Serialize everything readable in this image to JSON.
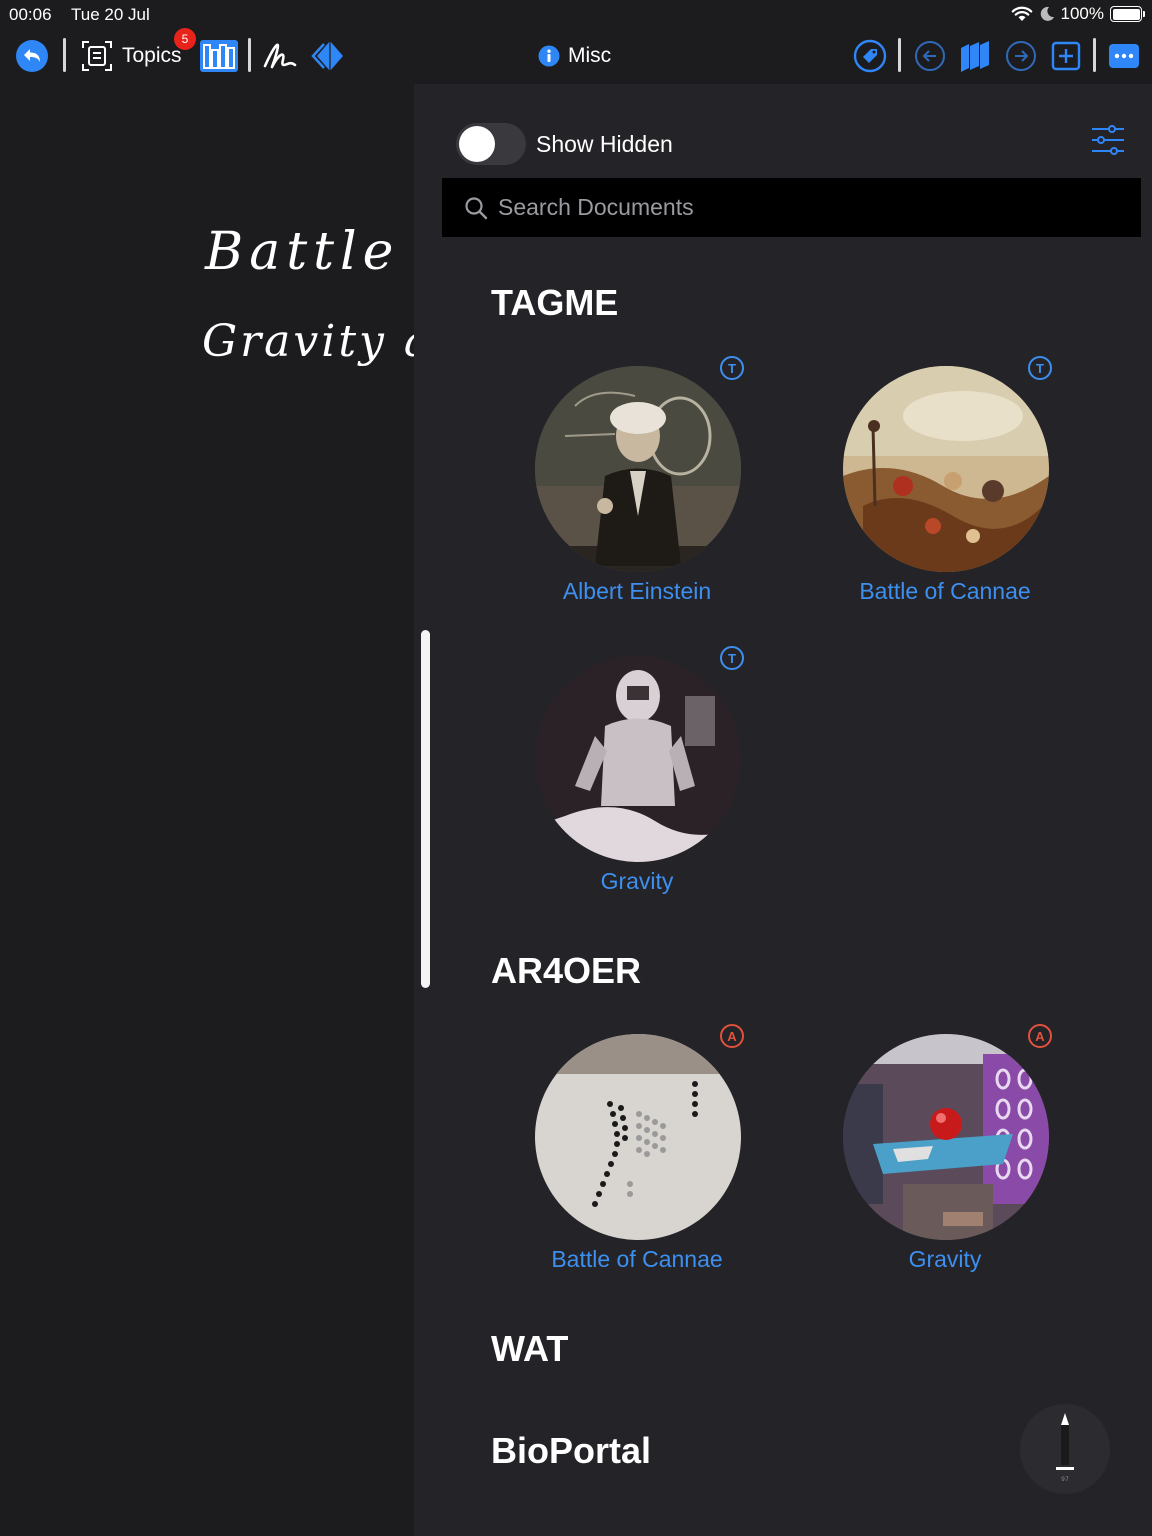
{
  "status": {
    "time": "00:06",
    "date": "Tue 20 Jul",
    "battery": "100%"
  },
  "toolbar": {
    "topics_label": "Topics",
    "topics_badge": "5",
    "title": "Misc"
  },
  "note": {
    "line1": "Battle of",
    "line2": "Gravity and"
  },
  "library": {
    "show_hidden_label": "Show Hidden",
    "show_hidden_on": false,
    "search_placeholder": "Search Documents",
    "sections": [
      {
        "title": "TAGME",
        "docs": [
          {
            "label": "Albert Einstein",
            "tag": "T"
          },
          {
            "label": "Battle of Cannae",
            "tag": "T"
          },
          {
            "label": "Gravity",
            "tag": "T"
          }
        ]
      },
      {
        "title": "AR4OER",
        "docs": [
          {
            "label": "Battle of Cannae",
            "tag": "A"
          },
          {
            "label": "Gravity",
            "tag": "A"
          }
        ]
      },
      {
        "title": "WAT",
        "docs": []
      },
      {
        "title": "BioPortal",
        "docs": []
      }
    ]
  },
  "colors": {
    "accent": "#3d8ff0",
    "tag_red": "#e2513c",
    "badge": "#e8231a",
    "panel": "#242428",
    "background": "#1c1c1e"
  },
  "icons": [
    "back-icon",
    "topics-icon",
    "library-icon",
    "scribble-icon",
    "diamond-icon",
    "info-icon",
    "tag-icon",
    "prev-page-icon",
    "books-icon",
    "next-page-icon",
    "add-icon",
    "more-icon",
    "filter-icon",
    "search-icon",
    "pencil-icon",
    "wifi-icon",
    "moon-icon",
    "battery-icon"
  ]
}
